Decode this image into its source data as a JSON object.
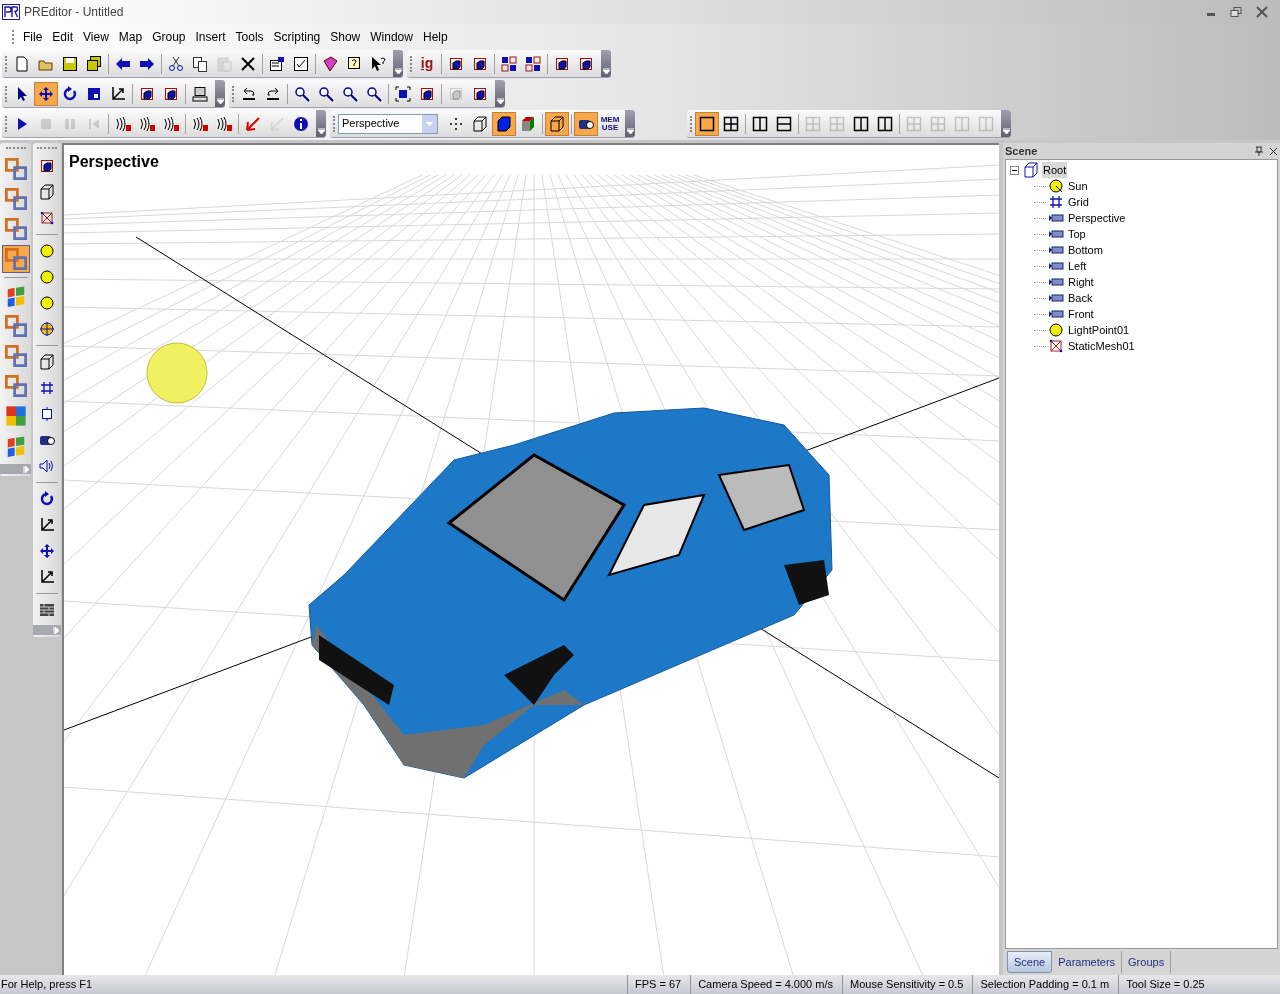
{
  "window": {
    "title": "PREditor - Untitled"
  },
  "menu": [
    "File",
    "Edit",
    "View",
    "Map",
    "Group",
    "Insert",
    "Tools",
    "Scripting",
    "Show",
    "Window",
    "Help"
  ],
  "toolbars": [
    {
      "groups": [
        [
          {
            "kind": "new",
            "selected": false,
            "disabled": false
          },
          {
            "kind": "open",
            "selected": false,
            "disabled": false
          },
          {
            "kind": "save",
            "selected": false,
            "disabled": false
          },
          {
            "kind": "saveall",
            "selected": false,
            "disabled": false
          }
        ],
        [
          {
            "kind": "back",
            "selected": false,
            "disabled": false
          },
          {
            "kind": "forward",
            "selected": false,
            "disabled": false
          }
        ],
        [
          {
            "kind": "cut",
            "selected": false,
            "disabled": false
          },
          {
            "kind": "copy",
            "selected": false,
            "disabled": false
          },
          {
            "kind": "paste",
            "selected": false,
            "disabled": true
          },
          {
            "kind": "delete",
            "selected": false,
            "disabled": false
          }
        ],
        [
          {
            "kind": "props",
            "selected": false,
            "disabled": false
          },
          {
            "kind": "check",
            "selected": false,
            "disabled": false
          }
        ],
        [
          {
            "kind": "book",
            "selected": false,
            "disabled": false
          },
          {
            "kind": "help",
            "selected": false,
            "disabled": false
          },
          {
            "kind": "pointerhelp",
            "selected": false,
            "disabled": false
          }
        ]
      ]
    },
    {
      "groups": [
        [
          {
            "kind": "text",
            "label": "ig",
            "selected": false,
            "disabled": false
          }
        ],
        [
          {
            "kind": "cube",
            "selected": false,
            "disabled": false
          },
          {
            "kind": "cube",
            "selected": false,
            "disabled": false
          }
        ],
        [
          {
            "kind": "cubes",
            "selected": false,
            "disabled": false
          },
          {
            "kind": "cubes",
            "selected": false,
            "disabled": false
          }
        ],
        [
          {
            "kind": "cube",
            "selected": false,
            "disabled": false
          },
          {
            "kind": "cube",
            "selected": false,
            "disabled": false
          }
        ]
      ]
    },
    {
      "groups": [
        [
          {
            "kind": "pointer",
            "selected": false,
            "disabled": false
          },
          {
            "kind": "move",
            "selected": true,
            "disabled": false
          },
          {
            "kind": "rotate",
            "selected": false,
            "disabled": false
          },
          {
            "kind": "scale",
            "selected": false,
            "disabled": false
          },
          {
            "kind": "resize",
            "selected": false,
            "disabled": false
          }
        ],
        [
          {
            "kind": "cube",
            "selected": false,
            "disabled": false
          },
          {
            "kind": "cube",
            "selected": false,
            "disabled": false
          }
        ],
        [
          {
            "kind": "computer",
            "selected": false,
            "disabled": false
          }
        ]
      ]
    },
    {
      "groups": [
        [
          {
            "kind": "undo",
            "selected": false,
            "disabled": false
          },
          {
            "kind": "redo",
            "selected": false,
            "disabled": false
          }
        ],
        [
          {
            "kind": "zoom",
            "selected": false,
            "disabled": false
          },
          {
            "kind": "zoom",
            "selected": false,
            "disabled": false
          },
          {
            "kind": "zoom",
            "selected": false,
            "disabled": false
          },
          {
            "kind": "zoom",
            "selected": false,
            "disabled": false
          }
        ],
        [
          {
            "kind": "fit",
            "selected": false,
            "disabled": false
          },
          {
            "kind": "cube",
            "selected": false,
            "disabled": false
          }
        ],
        [
          {
            "kind": "cube",
            "selected": false,
            "disabled": true
          },
          {
            "kind": "cube",
            "selected": false,
            "disabled": false
          }
        ]
      ]
    },
    {
      "groups": [
        [
          {
            "kind": "play",
            "selected": false,
            "disabled": false
          },
          {
            "kind": "stop",
            "selected": false,
            "disabled": true
          },
          {
            "kind": "pause",
            "selected": false,
            "disabled": true
          },
          {
            "kind": "rewind",
            "selected": false,
            "disabled": true
          }
        ],
        [
          {
            "kind": "sound",
            "selected": false,
            "disabled": false
          },
          {
            "kind": "sound",
            "selected": false,
            "disabled": false
          },
          {
            "kind": "sound",
            "selected": false,
            "disabled": false
          }
        ],
        [
          {
            "kind": "sound",
            "selected": false,
            "disabled": false
          },
          {
            "kind": "sound",
            "selected": false,
            "disabled": false
          }
        ],
        [
          {
            "kind": "arrow",
            "selected": false,
            "disabled": false
          },
          {
            "kind": "arrow",
            "selected": false,
            "disabled": true
          },
          {
            "kind": "info",
            "selected": false,
            "disabled": false
          }
        ]
      ]
    },
    {
      "dropdown": "Perspective",
      "groups": [
        [
          {
            "kind": "points",
            "selected": false,
            "disabled": false
          },
          {
            "kind": "wire",
            "selected": false,
            "disabled": false
          },
          {
            "kind": "solid",
            "selected": true,
            "disabled": false
          },
          {
            "kind": "color",
            "selected": false,
            "disabled": false
          }
        ],
        [
          {
            "kind": "wire",
            "selected": true,
            "disabled": false
          }
        ],
        [
          {
            "kind": "camera",
            "selected": true,
            "disabled": false
          },
          {
            "kind": "text",
            "label": "MEM USE",
            "selected": false,
            "disabled": false
          }
        ]
      ]
    },
    {
      "groups": [
        [
          {
            "kind": "single",
            "selected": true,
            "disabled": false
          },
          {
            "kind": "quad",
            "selected": false,
            "disabled": false
          }
        ],
        [
          {
            "kind": "vsplit",
            "selected": false,
            "disabled": false
          },
          {
            "kind": "hsplit",
            "selected": false,
            "disabled": false
          }
        ],
        [
          {
            "kind": "quad",
            "selected": false,
            "disabled": true
          },
          {
            "kind": "quad",
            "selected": false,
            "disabled": true
          },
          {
            "kind": "vsplit",
            "selected": false,
            "disabled": false
          },
          {
            "kind": "vsplit",
            "selected": false,
            "disabled": false
          }
        ],
        [
          {
            "kind": "quad",
            "selected": false,
            "disabled": true
          },
          {
            "kind": "quad",
            "selected": false,
            "disabled": true
          },
          {
            "kind": "vsplit",
            "selected": false,
            "disabled": true
          },
          {
            "kind": "vsplit",
            "selected": false,
            "disabled": true
          }
        ]
      ]
    }
  ],
  "left_palette": [
    [
      {
        "kind": "blocks",
        "selected": false
      },
      {
        "kind": "blocks",
        "selected": false
      },
      {
        "kind": "blocks",
        "selected": false
      },
      {
        "kind": "blocks",
        "selected": true
      }
    ],
    [
      {
        "kind": "flag",
        "selected": false
      },
      {
        "kind": "blocks",
        "selected": false
      },
      {
        "kind": "blocks",
        "selected": false
      },
      {
        "kind": "blocks",
        "selected": false
      },
      {
        "kind": "puzzle",
        "selected": false
      },
      {
        "kind": "flag",
        "selected": false
      }
    ]
  ],
  "object_palette": [
    [
      {
        "kind": "cube"
      },
      {
        "kind": "wire"
      },
      {
        "kind": "mesh"
      }
    ],
    [
      {
        "kind": "light"
      },
      {
        "kind": "light"
      },
      {
        "kind": "light"
      },
      {
        "kind": "globe"
      }
    ],
    [
      {
        "kind": "wire"
      },
      {
        "kind": "grid"
      },
      {
        "kind": "frame"
      },
      {
        "kind": "camera"
      },
      {
        "kind": "speaker"
      }
    ],
    [
      {
        "kind": "rotate"
      },
      {
        "kind": "resize"
      },
      {
        "kind": "move"
      },
      {
        "kind": "resize"
      }
    ],
    [
      {
        "kind": "wall"
      }
    ]
  ],
  "viewport": {
    "label": "Perspective"
  },
  "scene_panel": {
    "title": "Scene",
    "tree": [
      {
        "label": "Root",
        "kind": "root",
        "selected": true,
        "expanded": true,
        "children": [
          {
            "label": "Sun",
            "kind": "sun",
            "selected": false
          },
          {
            "label": "Grid",
            "kind": "grid",
            "selected": false
          },
          {
            "label": "Perspective",
            "kind": "camera",
            "selected": false
          },
          {
            "label": "Top",
            "kind": "camera",
            "selected": false
          },
          {
            "label": "Bottom",
            "kind": "camera",
            "selected": false
          },
          {
            "label": "Left",
            "kind": "camera",
            "selected": false
          },
          {
            "label": "Right",
            "kind": "camera",
            "selected": false
          },
          {
            "label": "Back",
            "kind": "camera",
            "selected": false
          },
          {
            "label": "Front",
            "kind": "camera",
            "selected": false
          },
          {
            "label": "LightPoint01",
            "kind": "light",
            "selected": false
          },
          {
            "label": "StaticMesh01",
            "kind": "mesh",
            "selected": false
          }
        ]
      }
    ],
    "tabs": [
      {
        "label": "Scene",
        "selected": true
      },
      {
        "label": "Parameters",
        "selected": false
      },
      {
        "label": "Groups",
        "selected": false
      }
    ]
  },
  "status_bar": {
    "help": "For Help, press F1",
    "fields": [
      "FPS = 67",
      "Camera Speed = 4.000 m/s",
      "Mouse Sensitivity = 0.5",
      "Selection Padding = 0.1 m",
      "Tool Size = 0.25"
    ]
  }
}
